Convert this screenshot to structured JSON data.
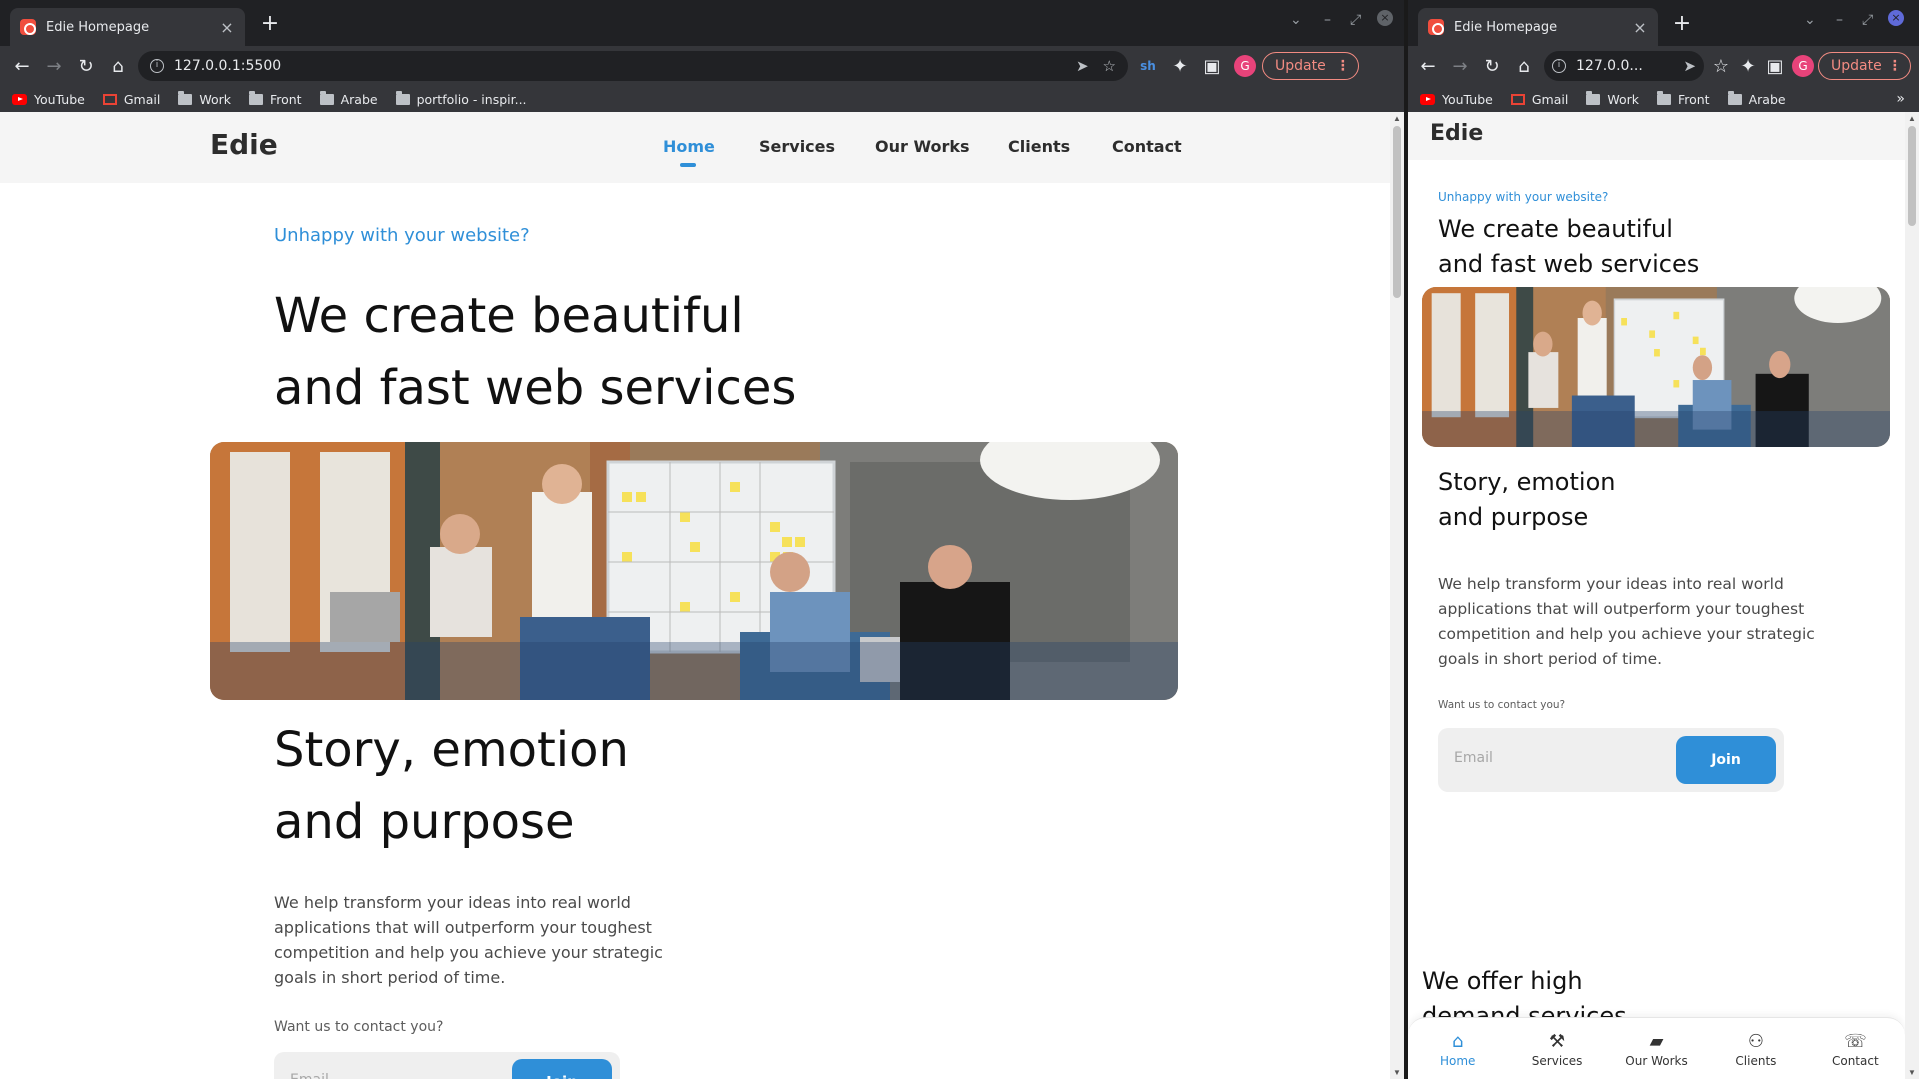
{
  "browser": {
    "tab_title": "Edie Homepage",
    "url_full": "127.0.0.1:5500",
    "url_narrow": "127.0.0...",
    "update_label": "Update",
    "avatar_initial": "G",
    "extension_label": "sh",
    "bookmarks_wide": [
      "YouTube",
      "Gmail",
      "Work",
      "Front",
      "Arabe",
      "portfolio - inspir..."
    ],
    "bookmarks_narrow": [
      "YouTube",
      "Gmail",
      "Work",
      "Front",
      "Arabe"
    ]
  },
  "site": {
    "logo": "Edie",
    "nav": [
      "Home",
      "Services",
      "Our Works",
      "Clients",
      "Contact"
    ],
    "hero": {
      "eyebrow": "Unhappy with your website?",
      "title_line1": "We create beautiful",
      "title_line2": "and fast web services"
    },
    "story": {
      "title_line1": "Story, emotion",
      "title_line2": "and purpose",
      "para_lines": [
        "We help transform your ideas into real world",
        "applications that will outperform your toughest",
        "competition and help you achieve your strategic",
        "goals in short period of time."
      ],
      "contact_prompt": "Want us to contact you?",
      "email_placeholder": "Email",
      "join_label": "Join"
    },
    "services": {
      "title_line1": "We offer high",
      "title_line2": "demand services"
    },
    "bottom_nav": [
      {
        "label": "Home",
        "icon": "home-icon"
      },
      {
        "label": "Services",
        "icon": "tools-icon"
      },
      {
        "label": "Our Works",
        "icon": "briefcase-icon"
      },
      {
        "label": "Clients",
        "icon": "people-icon"
      },
      {
        "label": "Contact",
        "icon": "phone-icon"
      }
    ]
  },
  "colors": {
    "accent": "#2f8fd8",
    "browser_dark": "#202124",
    "toolbar": "#35363a",
    "header_bg": "#f5f5f5"
  }
}
